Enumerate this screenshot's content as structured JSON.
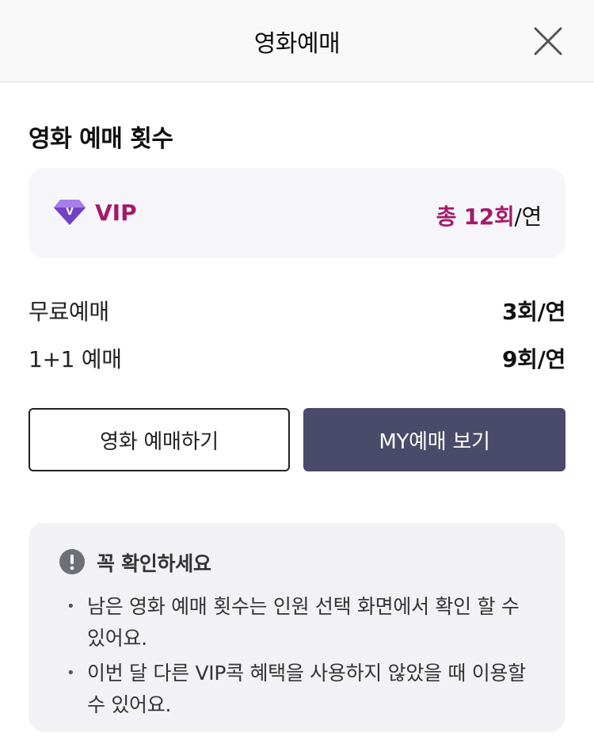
{
  "header": {
    "title": "영화예매",
    "close_icon": "close-icon"
  },
  "section": {
    "title": "영화 예매 횟수"
  },
  "tier": {
    "icon": "vip-gem-icon",
    "gem_letter": "V",
    "name": "VIP",
    "total_accent": "총 12회",
    "total_unit": "/연",
    "accent_color": "#a41a6b"
  },
  "rows": [
    {
      "label": "무료예매",
      "value": "3회/연"
    },
    {
      "label": "1+1 예매",
      "value": "9회/연"
    }
  ],
  "buttons": {
    "reserve_label": "영화 예매하기",
    "my_reservations_label": "MY예매 보기"
  },
  "notice": {
    "icon": "exclamation-circle-icon",
    "title": "꼭 확인하세요",
    "items": [
      "남은 영화 예매 횟수는 인원 선택 화면에서 확인 할 수 있어요.",
      "이번 달 다른 VIP콕 혜택을 사용하지 않았을 때 이용할 수 있어요."
    ]
  }
}
